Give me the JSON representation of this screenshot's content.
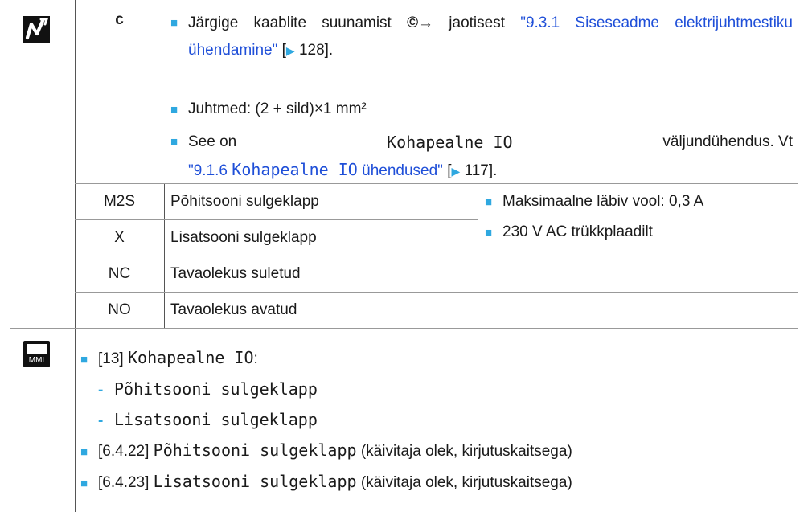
{
  "top": {
    "code": "c",
    "bullet1_a": "Järgige kaablite suunamist",
    "bullet1_symbol": "©→",
    "bullet1_b": "jaotisest",
    "bullet1_link": "\"9.3.1 Siseseadme elektrijuhtmestiku ühendamine\"",
    "bullet1_ref": "128].",
    "bullet2": "Juhtmed: (2 + sild)×1 mm²",
    "bullet3_a": "See on",
    "bullet3_mono": "Kohapealne IO",
    "bullet3_b": "väljundühendus. Vt",
    "bullet3_link_a": "\"9.1.6",
    "bullet3_link_mono": "Kohapealne IO",
    "bullet3_link_b": "ühendused\"",
    "bullet3_ref": "117]."
  },
  "rows": [
    {
      "code": "M2S",
      "desc": "Põhitsooni sulgeklapp"
    },
    {
      "code": "X",
      "desc": "Lisatsooni sulgeklapp"
    },
    {
      "code": "NC",
      "desc": "Tavaolekus suletud"
    },
    {
      "code": "NO",
      "desc": "Tavaolekus avatud"
    }
  ],
  "spec": {
    "max_current": "Maksimaalne läbiv vool: 0,3 A",
    "supply": "230 V AC trükkplaadilt"
  },
  "mmi": {
    "icon_label": "MMI",
    "item1_prefix": "[13]",
    "item1_mono": "Kohapealne IO",
    "item1_suffix": ":",
    "sub1": "Põhitsooni sulgeklapp",
    "sub2": "Lisatsooni sulgeklapp",
    "item2_prefix": "[6.4.22]",
    "item2_mono": "Põhitsooni sulgeklapp",
    "item2_suffix": "(käivitaja olek, kirjutuskaitsega)",
    "item3_prefix": "[6.4.23]",
    "item3_mono": "Lisatsooni sulgeklapp",
    "item3_suffix": "(käivitaja olek, kirjutuskaitsega)"
  },
  "colors": {
    "accent": "#2fa8e0",
    "link": "#1f4fd8"
  },
  "icons": [
    "wiring-plug-icon",
    "mmi-screen-icon",
    "copyright-arrow-icon",
    "page-ref-arrow-icon"
  ]
}
